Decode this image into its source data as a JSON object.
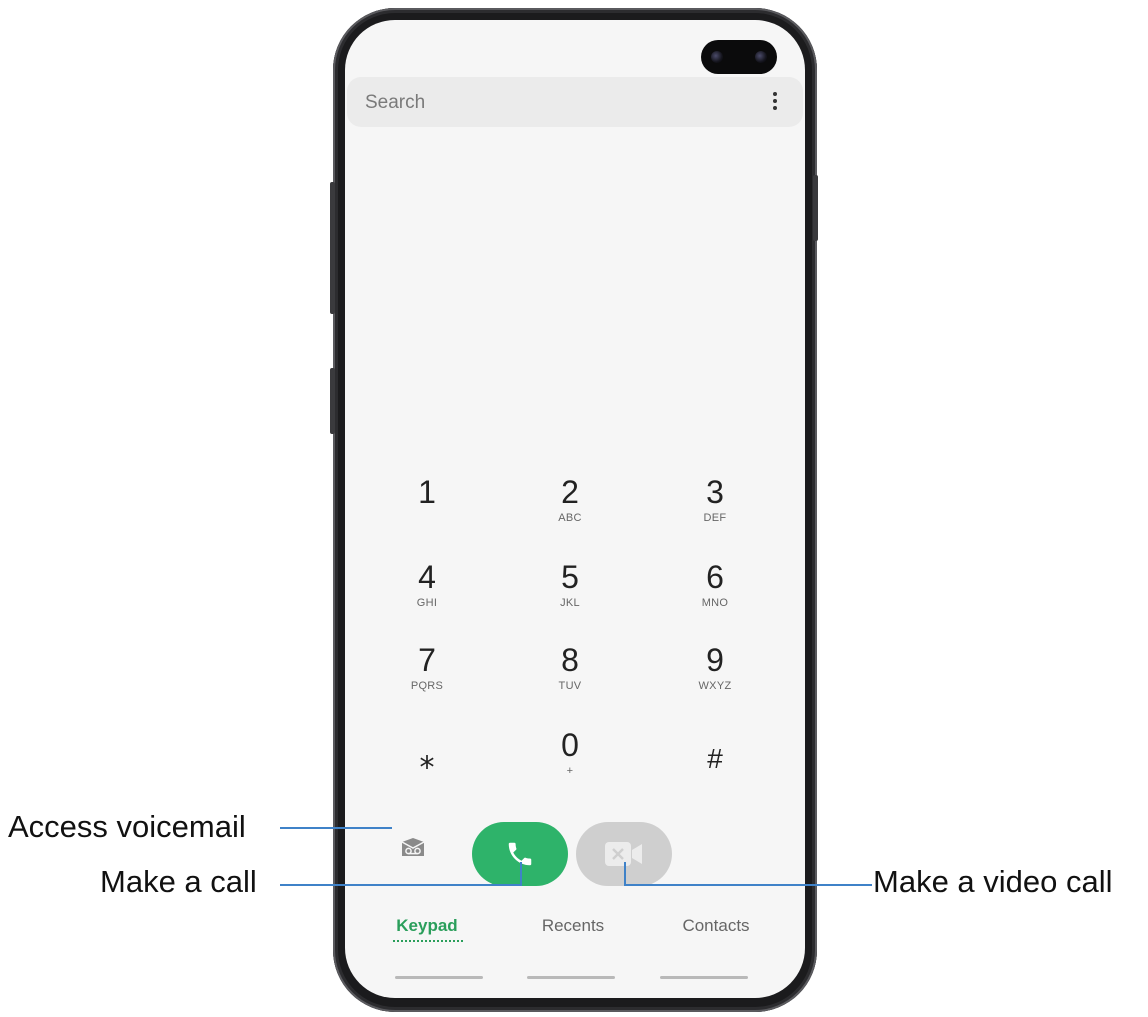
{
  "search": {
    "placeholder": "Search"
  },
  "keys": [
    {
      "digit": "1",
      "letters": ""
    },
    {
      "digit": "2",
      "letters": "ABC"
    },
    {
      "digit": "3",
      "letters": "DEF"
    },
    {
      "digit": "4",
      "letters": "GHI"
    },
    {
      "digit": "5",
      "letters": "JKL"
    },
    {
      "digit": "6",
      "letters": "MNO"
    },
    {
      "digit": "7",
      "letters": "PQRS"
    },
    {
      "digit": "8",
      "letters": "TUV"
    },
    {
      "digit": "9",
      "letters": "WXYZ"
    },
    {
      "digit": "⁎",
      "letters": ""
    },
    {
      "digit": "0",
      "letters": "+"
    },
    {
      "digit": "#",
      "letters": ""
    }
  ],
  "tabs": [
    {
      "label": "Keypad",
      "active": true
    },
    {
      "label": "Recents",
      "active": false
    },
    {
      "label": "Contacts",
      "active": false
    }
  ],
  "icons": {
    "more": "more-vertical-icon",
    "voicemail": "voicemail-icon",
    "call": "phone-icon",
    "video": "video-call-icon"
  },
  "colors": {
    "accent": "#2a9e5b",
    "call_button": "#2eb36a",
    "video_button": "#cfcfcf",
    "callout_line": "#3f82c8"
  },
  "callouts": {
    "voicemail": "Access voicemail",
    "call": "Make a call",
    "video": "Make a video call"
  }
}
